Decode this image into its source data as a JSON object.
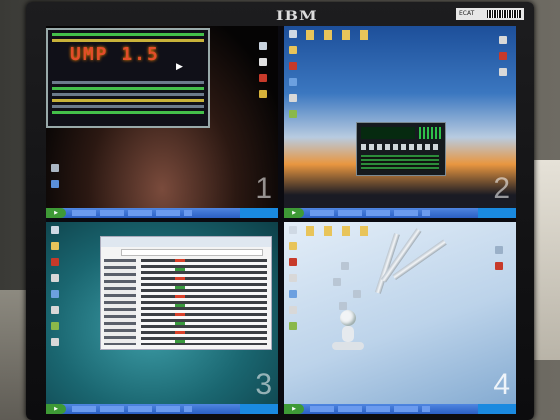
{
  "monitor": {
    "brand": "IBM",
    "asset_label": "ECAT"
  },
  "quadrants": [
    {
      "number": "1",
      "content": "terminal",
      "banner_text": "UMP 1.5"
    },
    {
      "number": "2",
      "content": "media-player"
    },
    {
      "number": "3",
      "content": "file-explorer"
    },
    {
      "number": "4",
      "content": "desktop"
    }
  ],
  "colors": {
    "taskbar": "#2a5fc4",
    "start_button": "#3e9a36"
  }
}
